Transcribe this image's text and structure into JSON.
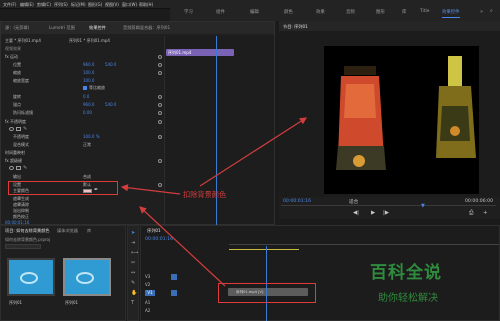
{
  "menu": {
    "items": [
      "文件(F)",
      "编辑(E)",
      "剪辑(C)",
      "序列(S)",
      "标记(M)",
      "图形(G)",
      "视图(V)",
      "窗口(W)",
      "帮助(H)"
    ]
  },
  "workspace": {
    "tabs": [
      "学习",
      "组件",
      "编辑",
      "颜色",
      "效果",
      "音频",
      "图形",
      "库",
      "Title",
      "",
      ""
    ],
    "active": "效果控件"
  },
  "effect_controls": {
    "tabs": [
      "源：(无剪辑)",
      "Lumetri 范围",
      "效果控件",
      "音频剪辑混合器：序列01"
    ],
    "header_master": "主要 * 序列01.mp4",
    "header_seq": "序列01 * 序列01.mp4",
    "section_video": "视频效果",
    "motion": "fx 运动",
    "position_label": "位置",
    "position_x": "960.0",
    "position_y": "540.0",
    "scale_label": "缩放",
    "scale_value": "100.0",
    "scale_width_label": "缩放宽度",
    "scale_width_value": "100.0",
    "uniform_scale": "等比缩放",
    "rotation_label": "旋转",
    "rotation_value": "0.0",
    "anchor_label": "锚点",
    "anchor_x": "960.0",
    "anchor_y": "540.0",
    "flicker_label": "防闪烁滤镜",
    "flicker_value": "0.00",
    "opacity": "fx 不透明度",
    "opacity_label": "不透明度",
    "opacity_value": "100.0 %",
    "blend_label": "混合模式",
    "blend_value": "正常",
    "time_remap": "时间重映射",
    "ultra_key": "fx 超级键",
    "output_label": "输出",
    "output_value": "合成",
    "settings_label": "设置",
    "settings_value": "默认",
    "key_color_label": "主要颜色",
    "matte_gen_label": "遮罩生成",
    "matte_clean_label": "遮罩清除",
    "spill_label": "溢出抑制",
    "color_label": "颜色校正",
    "timecode": "00:00:01:16",
    "clip_name": "序列01.mp4"
  },
  "program": {
    "title": "节目: 序列01",
    "timecode_left": "00:00:01:16",
    "fit": "适合",
    "timecode_right": "00:00:06:00"
  },
  "project": {
    "tabs": [
      "项目: 如何去除背景颜色",
      "媒体浏览器",
      "库"
    ],
    "path": "如何去除背景颜色.prproj",
    "items": [
      "序列01",
      "序列01"
    ]
  },
  "timeline": {
    "tab": "序列01",
    "timecode": "00:00:01:16",
    "tracks": [
      "V3",
      "V2",
      "V1",
      "A1",
      "A2"
    ],
    "clip_label": "序列01.mp4 [V]"
  },
  "annotation": {
    "text": "扣除背景颜色",
    "color": "#d33d3d"
  },
  "logo": {
    "title": "百科全说",
    "subtitle": "助你轻松解决"
  },
  "colors": {
    "accent": "#4a86e8",
    "clip_purple": "#7a63b4",
    "highlight_red": "#e03b3b",
    "logo_green": "#2f8b3d"
  }
}
